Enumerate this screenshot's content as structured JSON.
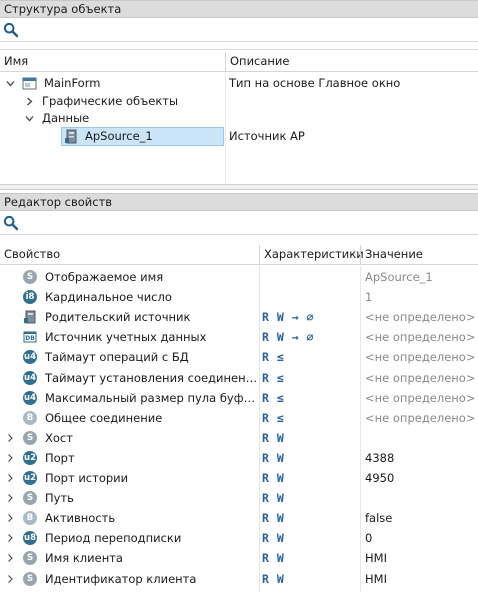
{
  "structure_panel": {
    "title": "Структура объекта",
    "columns": {
      "name": "Имя",
      "description": "Описание"
    },
    "tree": [
      {
        "label": "MainForm",
        "description": "Тип на основе Главное окно"
      },
      {
        "label": "Графические объекты",
        "description": ""
      },
      {
        "label": "Данные",
        "description": ""
      },
      {
        "label": "ApSource_1",
        "description": "Источник AP"
      }
    ]
  },
  "property_panel": {
    "title": "Редактор свойств",
    "columns": {
      "property": "Свойство",
      "characteristics": "Характеристики",
      "value": "Значение"
    },
    "rows": [
      {
        "badge": "S",
        "name": "Отображаемое имя",
        "chars": "",
        "value": "ApSource_1",
        "muted": true
      },
      {
        "badge": "i8",
        "name": "Кардинальное число",
        "chars": "",
        "value": "1",
        "muted": true
      },
      {
        "badge": "ref",
        "name": "Родительский источник",
        "chars": "R W → ∅",
        "value": "<не определено>",
        "muted": true
      },
      {
        "badge": "db",
        "name": "Источник учетных данных",
        "chars": "R W → ∅",
        "value": "<не определено>",
        "muted": true
      },
      {
        "badge": "u4",
        "name": "Таймаут операций с БД",
        "chars": "R ≤",
        "value": "<не определено>",
        "muted": true
      },
      {
        "badge": "u4",
        "name": "Таймаут установления соединения с...",
        "chars": "R ≤",
        "value": "<не определено>",
        "muted": true
      },
      {
        "badge": "u4",
        "name": "Максимальный размер пула буферов",
        "chars": "R ≤",
        "value": "<не определено>",
        "muted": true
      },
      {
        "badge": "B",
        "name": "Общее соединение",
        "chars": "R ≤",
        "value": "<не определено>",
        "muted": true
      },
      {
        "badge": "S",
        "name": "Хост",
        "chars": "R W",
        "value": "",
        "muted": false
      },
      {
        "badge": "u2",
        "name": "Порт",
        "chars": "R W",
        "value": "4388",
        "muted": false
      },
      {
        "badge": "u2",
        "name": "Порт истории",
        "chars": "R W",
        "value": "4950",
        "muted": false
      },
      {
        "badge": "S",
        "name": "Путь",
        "chars": "R W",
        "value": "",
        "muted": false
      },
      {
        "badge": "B",
        "name": "Активность",
        "chars": "R W",
        "value": "false",
        "muted": false
      },
      {
        "badge": "u8",
        "name": "Период переподписки",
        "chars": "R W",
        "value": "0",
        "muted": false
      },
      {
        "badge": "S",
        "name": "Имя клиента",
        "chars": "R W",
        "value": "HMI",
        "muted": false
      },
      {
        "badge": "S",
        "name": "Идентификатор клиента",
        "chars": "R W",
        "value": "HMI",
        "muted": false
      }
    ]
  },
  "colors": {
    "selection": "#cce4f7",
    "selection_border": "#99c9ef",
    "header_bg": "#dcdcdc",
    "rw_text": "#2563a6",
    "muted_text": "#8a8a8a"
  },
  "icons": {
    "search": "search-icon",
    "form": "window-form-icon",
    "source": "ap-source-icon"
  }
}
